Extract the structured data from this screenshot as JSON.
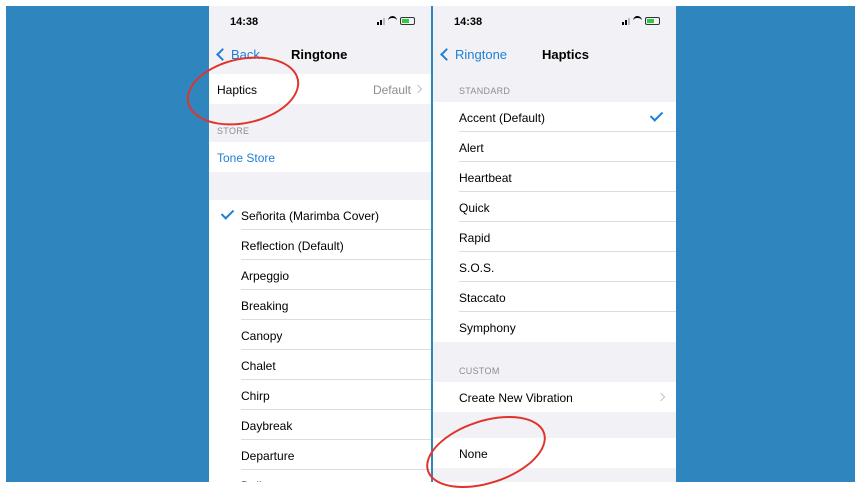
{
  "left": {
    "status_time": "14:38",
    "back_label": "Back",
    "title": "Ringtone",
    "haptics_label": "Haptics",
    "haptics_value": "Default",
    "store_header": "STORE",
    "tone_store": "Tone Store",
    "ringtones": [
      "Señorita (Marimba Cover)",
      "Reflection (Default)",
      "Arpeggio",
      "Breaking",
      "Canopy",
      "Chalet",
      "Chirp",
      "Daybreak",
      "Departure",
      "Dollop"
    ]
  },
  "right": {
    "status_time": "14:38",
    "back_label": "Ringtone",
    "title": "Haptics",
    "standard_header": "STANDARD",
    "standard": [
      "Accent (Default)",
      "Alert",
      "Heartbeat",
      "Quick",
      "Rapid",
      "S.O.S.",
      "Staccato",
      "Symphony"
    ],
    "custom_header": "CUSTOM",
    "create_new": "Create New Vibration",
    "none_label": "None"
  },
  "colors": {
    "background": "#2f86bf",
    "accent": "#1e7fd6",
    "annotation": "#e0342b"
  }
}
